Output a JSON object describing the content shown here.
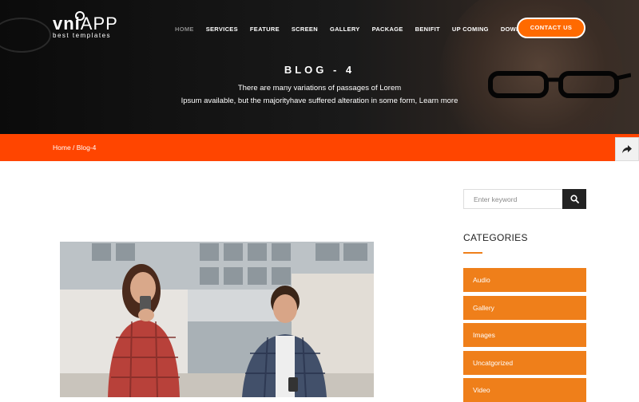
{
  "header": {
    "logo": {
      "brand_bold": "vni",
      "brand_thin": "APP",
      "tagline": "best templates"
    },
    "nav": [
      "HOME",
      "SERVICES",
      "FEATURE",
      "SCREEN",
      "GALLERY",
      "PACKAGE",
      "BENIFIT",
      "UP COMING",
      "DOWNLOAD APP"
    ],
    "active_nav": "HOME",
    "contact_label": "CONTACT US"
  },
  "hero": {
    "title": "BLOG - 4",
    "subtitle_line1": "There are many variations of passages of Lorem",
    "subtitle_line2": "Ipsum available, but the majorityhave suffered alteration in some form, Learn more"
  },
  "breadcrumb": {
    "home": "Home",
    "separator": " / ",
    "current": "Blog-4"
  },
  "sidebar": {
    "search_placeholder": "Enter keyword",
    "categories_title": "CATEGORIES",
    "categories": [
      "Audio",
      "Gallery",
      "Images",
      "Uncatgorized",
      "Video"
    ]
  },
  "colors": {
    "accent": "#ff4500",
    "category": "#ef7f1a",
    "button": "#ff6a00"
  },
  "icons": {
    "share": "share-arrow-icon",
    "search": "search-icon"
  }
}
